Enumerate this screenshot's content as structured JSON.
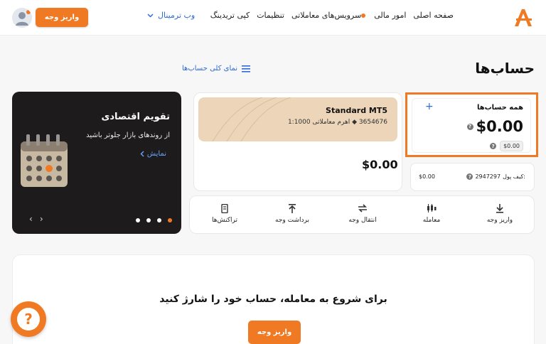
{
  "header": {
    "nav": {
      "home": "صفحه اصلی",
      "finance": "امور مالی",
      "trading_services": "سرویس‌های معاملاتی",
      "settings": "تنظیمات",
      "copy_trading": "کپی تریدینگ",
      "web_terminal": "وب ترمینال"
    },
    "deposit_button": "واریز وجه"
  },
  "page": {
    "title": "حساب‌ها",
    "overview_link": "نمای کلی حساب‌ها"
  },
  "calendar_card": {
    "title": "تقویم اقتصادی",
    "subtitle": "از روندهای بازار جلوتر باشید",
    "show_link": "نمایش"
  },
  "mt5_account": {
    "name": "Standard MT5",
    "number": "3654676",
    "leverage_label": "اهرم معاملاتی",
    "leverage": "1:1000",
    "balance": "$0.00"
  },
  "all_accounts": {
    "title": "همه حساب‌ها",
    "balance": "$0.00",
    "sub_balance": "$0.00"
  },
  "wallet": {
    "label": "کیف پول:",
    "id": "2947297",
    "balance": "$0.00"
  },
  "actions": [
    {
      "label": "واریز وجه"
    },
    {
      "label": "معامله"
    },
    {
      "label": "انتقال وجه"
    },
    {
      "label": "برداشت وجه"
    },
    {
      "label": "تراکنش‌ها"
    }
  ],
  "empty_state": {
    "text": "برای شروع به معامله، حساب خود را شارژ کنید",
    "button": "واریز وجه"
  },
  "colors": {
    "accent": "#f07a24",
    "link": "#2f6bd6"
  }
}
